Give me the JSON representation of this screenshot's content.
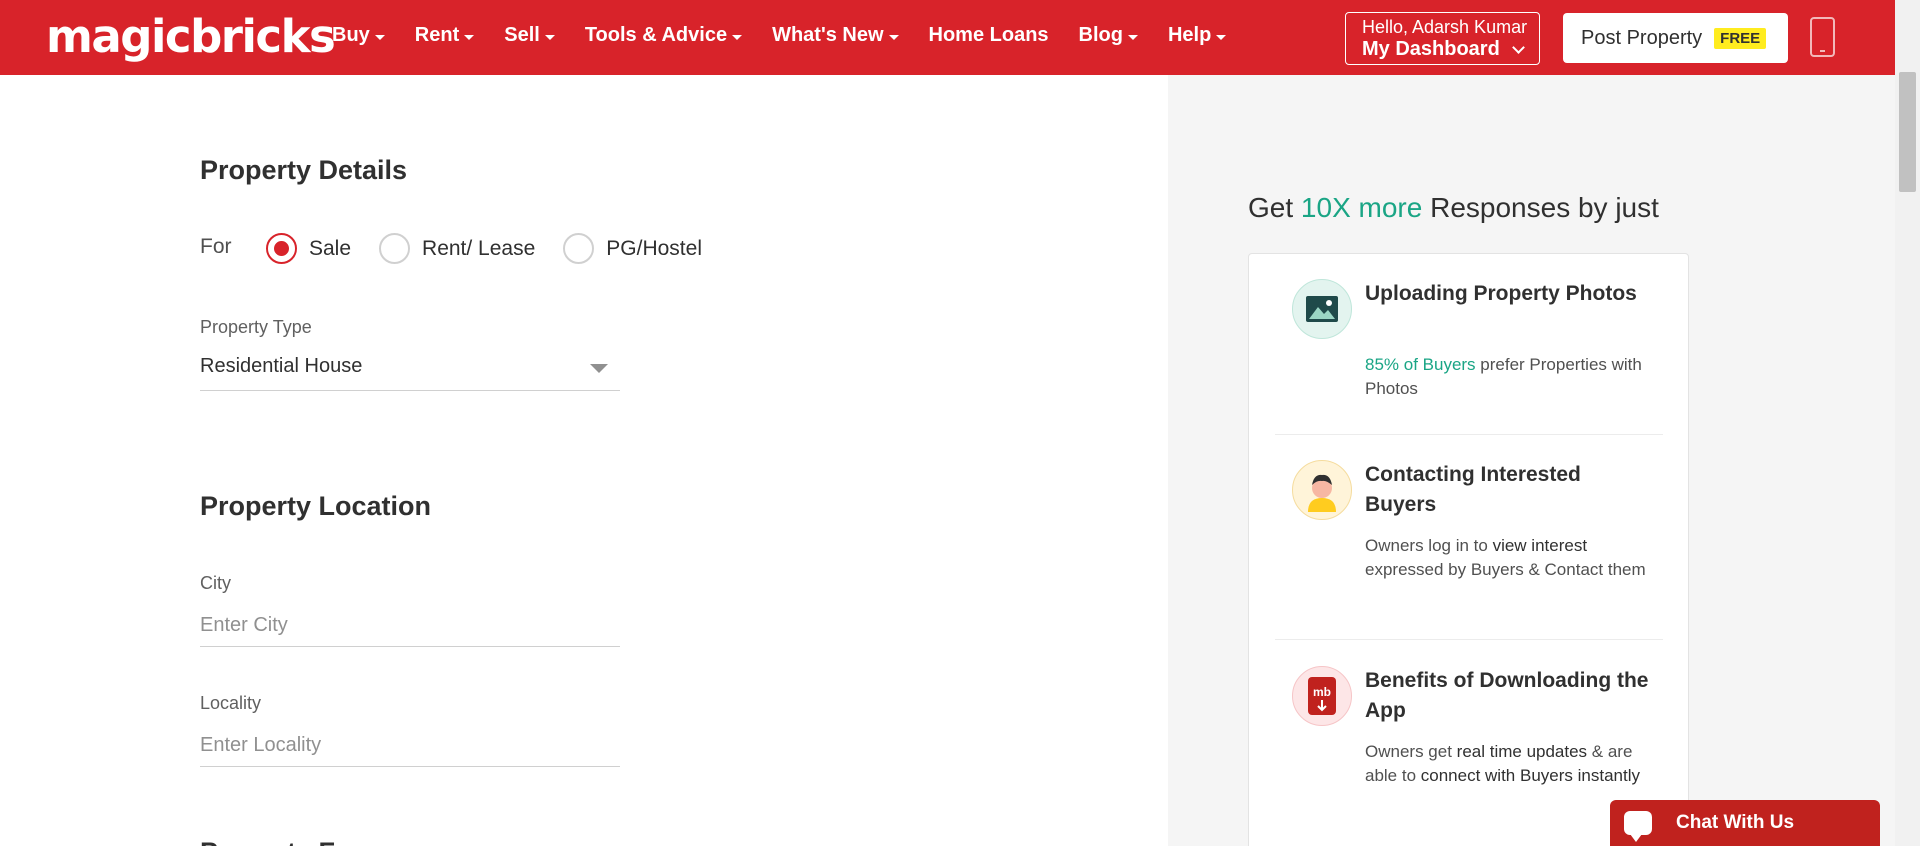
{
  "header": {
    "logo": "magicbricks",
    "nav": [
      {
        "label": "Buy",
        "dropdown": true
      },
      {
        "label": "Rent",
        "dropdown": true
      },
      {
        "label": "Sell",
        "dropdown": true
      },
      {
        "label": "Tools & Advice",
        "dropdown": true
      },
      {
        "label": "What's New",
        "dropdown": true
      },
      {
        "label": "Home Loans",
        "dropdown": false
      },
      {
        "label": "Blog",
        "dropdown": true
      },
      {
        "label": "Help",
        "dropdown": true
      }
    ],
    "greeting": "Hello, Adarsh Kumar",
    "dashboard_label": "My Dashboard",
    "post_property_label": "Post Property",
    "free_badge": "FREE",
    "brand_color": "#d8232a"
  },
  "form": {
    "property_details_title": "Property Details",
    "for_label": "For",
    "for_options": [
      {
        "label": "Sale",
        "checked": true
      },
      {
        "label": "Rent/ Lease",
        "checked": false
      },
      {
        "label": "PG/Hostel",
        "checked": false
      }
    ],
    "property_type_label": "Property Type",
    "property_type_value": "Residential House",
    "property_location_title": "Property Location",
    "city_label": "City",
    "city_placeholder": "Enter City",
    "locality_label": "Locality",
    "locality_placeholder": "Enter Locality",
    "next_section_title_partial": "Property F"
  },
  "side": {
    "heading_pre": "Get ",
    "heading_highlight": "10X more",
    "heading_post": " Responses by just",
    "highlight_color": "#1aa585",
    "benefits": [
      {
        "title": "Uploading Property Photos",
        "icon": "photo-icon",
        "desc_parts": [
          {
            "text": "85% of Buyers",
            "style": "green"
          },
          {
            "text": " prefer Properties with Photos",
            "style": "normal"
          }
        ]
      },
      {
        "title": "Contacting Interested Buyers",
        "icon": "buyer-avatar-icon",
        "desc_parts": [
          {
            "text": "Owners log in to ",
            "style": "normal"
          },
          {
            "text": "view interest",
            "style": "strong"
          },
          {
            "text": " expressed by Buyers & Contact them",
            "style": "normal"
          }
        ]
      },
      {
        "title": "Benefits of Downloading the App",
        "icon": "app-download-icon",
        "desc_parts": [
          {
            "text": "Owners get ",
            "style": "normal"
          },
          {
            "text": "real time updates",
            "style": "strong"
          },
          {
            "text": " & are able to ",
            "style": "normal"
          },
          {
            "text": "connect with Buyers instantly",
            "style": "strong"
          }
        ]
      }
    ]
  },
  "chat": {
    "label": "Chat With Us"
  }
}
